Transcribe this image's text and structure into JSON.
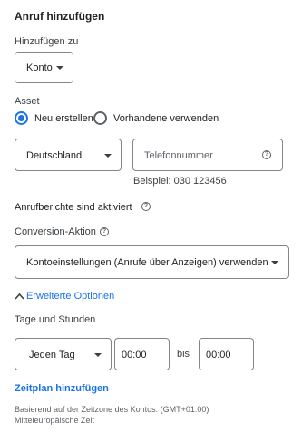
{
  "dialog": {
    "title": "Anruf hinzufügen"
  },
  "add_to": {
    "label": "Hinzufügen zu",
    "value": "Konto"
  },
  "asset": {
    "label": "Asset",
    "options": [
      {
        "label": "Neu erstellen",
        "selected": true
      },
      {
        "label": "Vorhandene verwenden",
        "selected": false
      }
    ]
  },
  "phone": {
    "country": "Deutschland",
    "number_placeholder": "Telefonnummer",
    "example": "Beispiel: 030 123456"
  },
  "call_reports": {
    "label": "Anrufberichte sind aktiviert",
    "icon": "help-icon"
  },
  "conversion": {
    "label": "Conversion-Aktion",
    "icon": "help-icon",
    "value": "Kontoeinstellungen (Anrufe über Anzeigen) verwenden"
  },
  "advanced": {
    "label": "Erweiterte Optionen",
    "icon": "chevron-up-icon"
  },
  "schedule": {
    "label": "Tage und Stunden",
    "day": "Jeden Tag",
    "from": "00:00",
    "separator": "bis",
    "to": "00:00",
    "add_link": "Zeitplan hinzufügen",
    "timezone_note": "Basierend auf der Zeitzone des Kontos: (GMT+01:00) Mitteleuropäische Zeit"
  },
  "colors": {
    "accent": "#1a73e8",
    "border": "#80868b",
    "text": "#202124"
  }
}
